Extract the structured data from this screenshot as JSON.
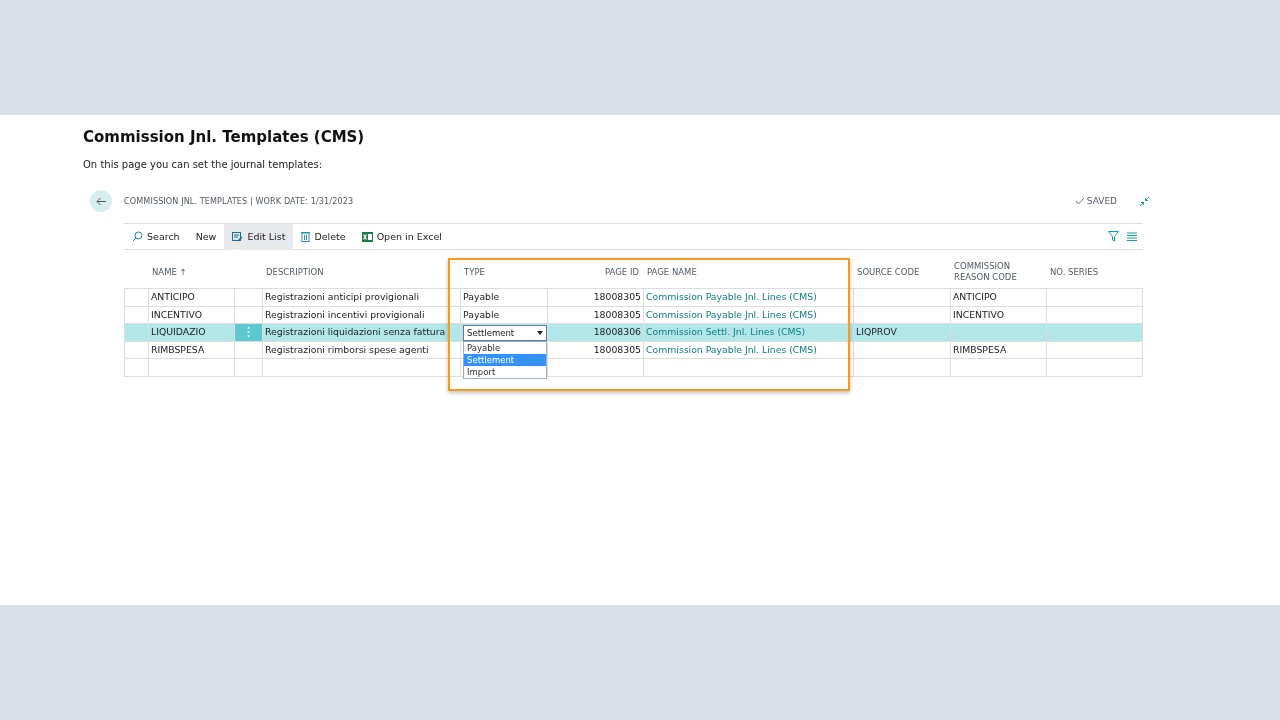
{
  "page": {
    "heading": "Commission Jnl. Templates (CMS)",
    "intro": "On this page you can set the journal templates:"
  },
  "app": {
    "title": "COMMISSION JNL. TEMPLATES | WORK DATE: 1/31/2023",
    "status": "SAVED",
    "actions": [
      {
        "label": "Search",
        "kind": "search",
        "selected": false
      },
      {
        "label": "New",
        "kind": "plain",
        "selected": false
      },
      {
        "label": "Edit List",
        "kind": "edit",
        "selected": true
      },
      {
        "label": "Delete",
        "kind": "delete",
        "selected": false
      },
      {
        "label": "Open in Excel",
        "kind": "excel",
        "selected": false
      }
    ],
    "columns": [
      {
        "label": "NAME",
        "sort": "↑",
        "kind": "text"
      },
      {
        "label": "DESCRIPTION",
        "kind": "text"
      },
      {
        "label": "TYPE",
        "kind": "text"
      },
      {
        "label": "PAGE ID",
        "kind": "number"
      },
      {
        "label": "PAGE NAME",
        "kind": "text"
      },
      {
        "label": "SOURCE CODE",
        "kind": "text"
      },
      {
        "label": "COMMISSION REASON CODE",
        "kind": "text"
      },
      {
        "label": "NO. SERIES",
        "kind": "text"
      }
    ],
    "rows": [
      {
        "name": "ANTICIPO",
        "description": "Registrazioni anticipi provigionali",
        "type": "Payable",
        "page_id": "18008305",
        "page_name": "Commission Payable Jnl. Lines (CMS)",
        "reason_code": "ANTICIPO",
        "selected": false
      },
      {
        "name": "INCENTIVO",
        "description": "Registrazioni incentivi provigionali",
        "type": "Payable",
        "page_id": "18008305",
        "page_name": "Commission Payable Jnl. Lines (CMS)",
        "reason_code": "INCENTIVO",
        "selected": false
      },
      {
        "name": "LIQUIDAZIO",
        "description": "Registrazioni liquidazioni senza fattura",
        "type": "Settlement",
        "page_id": "18008306",
        "page_name": "Commission Settl. Jnl. Lines (CMS)",
        "source_code": "LIQPROV",
        "selected": true,
        "type_options": [
          {
            "label": "Payable",
            "selected": false
          },
          {
            "label": "Settlement",
            "selected": true
          },
          {
            "label": "Import",
            "selected": false
          }
        ]
      },
      {
        "name": "RIMBSPESA",
        "description": "Registrazioni rimborsi spese agenti",
        "page_id": "18008305",
        "page_name": "Commission Payable Jnl. Lines (CMS)",
        "reason_code": "RIMBSPESA",
        "selected": false
      }
    ]
  }
}
